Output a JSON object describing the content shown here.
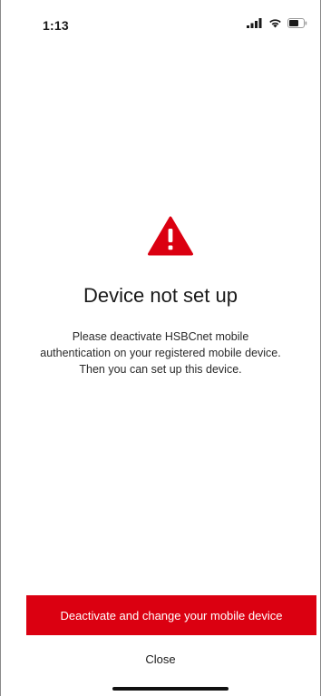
{
  "status_bar": {
    "time": "1:13",
    "icons": [
      "cellular-signal-icon",
      "wifi-icon",
      "battery-icon"
    ]
  },
  "content": {
    "icon": "warning-triangle-icon",
    "title": "Device not set up",
    "message_lines": [
      "Please deactivate HSBCnet mobile",
      "authentication on your registered mobile device.",
      "Then you can set up this device."
    ]
  },
  "actions": {
    "primary_label": "Deactivate and change your mobile device",
    "secondary_label": "Close"
  },
  "colors": {
    "brand_red": "#db0011",
    "text": "#1a1a1a",
    "background": "#ffffff"
  }
}
